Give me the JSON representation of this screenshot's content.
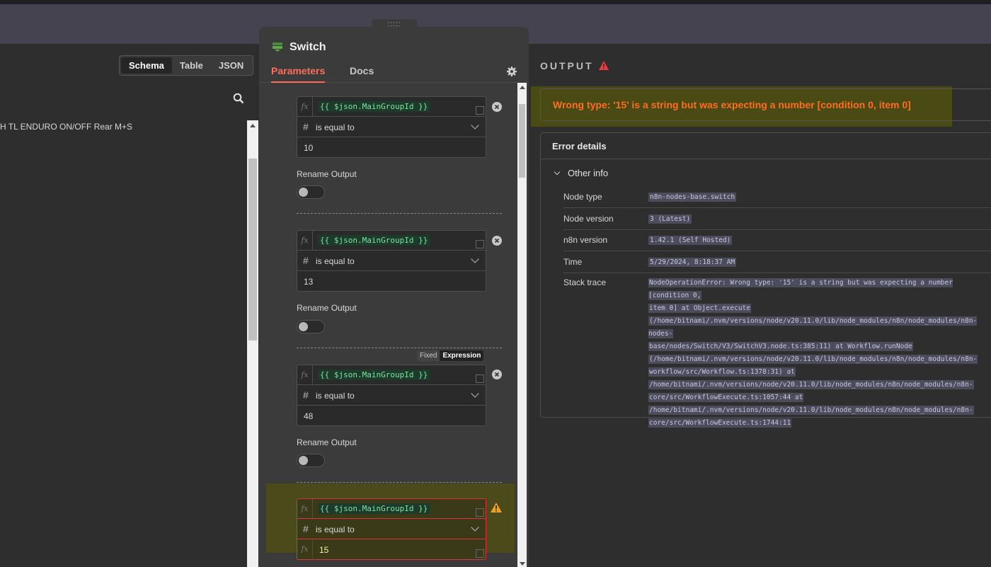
{
  "left": {
    "view_tabs": [
      "Schema",
      "Table",
      "JSON"
    ],
    "row_text": "H TL ENDURO ON/OFF Rear M+S"
  },
  "node": {
    "title": "Switch",
    "tabs": {
      "parameters": "Parameters",
      "docs": "Docs"
    },
    "fx_label": "fx",
    "rules": [
      {
        "expression": "{{ $json.MainGroupId }}",
        "operator": "is equal to",
        "value": "10"
      },
      {
        "expression": "{{ $json.MainGroupId }}",
        "operator": "is equal to",
        "value": "13"
      },
      {
        "expression": "{{ $json.MainGroupId }}",
        "operator": "is equal to",
        "value": "48"
      },
      {
        "expression": "{{ $json.MainGroupId }}",
        "operator": "is equal to",
        "value": "15"
      }
    ],
    "rename_output_label": "Rename Output",
    "fixed_label": "Fixed",
    "expression_label": "Expression",
    "drag_handle": ":::::"
  },
  "output": {
    "label": "OUTPUT",
    "error_message": "Wrong type: '15' is a string but was expecting a number [condition 0, item 0]",
    "details_title": "Error details",
    "other_info_label": "Other info",
    "info": {
      "node_type_key": "Node type",
      "node_type": "n8n-nodes-base.switch",
      "node_version_key": "Node version",
      "node_version": "3 (Latest)",
      "n8n_version_key": "n8n version",
      "n8n_version": "1.42.1 (Self Hosted)",
      "time_key": "Time",
      "time": "5/29/2024, 8:18:37 AM",
      "stack_key": "Stack trace"
    },
    "stack_lines": [
      "NodeOperationError: Wrong type: '15' is a string but was expecting a number [condition 0,",
      "item 0] at Object.execute",
      "(/home/bitnami/.nvm/versions/node/v20.11.0/lib/node_modules/n8n/node_modules/n8n-nodes-",
      "base/nodes/Switch/V3/SwitchV3.node.ts:385:11) at Workflow.runNode",
      "(/home/bitnami/.nvm/versions/node/v20.11.0/lib/node_modules/n8n/node_modules/n8n-",
      "workflow/src/Workflow.ts:1378:31) at",
      "/home/bitnami/.nvm/versions/node/v20.11.0/lib/node_modules/n8n/node_modules/n8n-",
      "core/src/WorkflowExecute.ts:1057:44 at",
      "/home/bitnami/.nvm/versions/node/v20.11.0/lib/node_modules/n8n/node_modules/n8n-",
      "core/src/WorkflowExecute.ts:1744:11"
    ]
  },
  "colors": {
    "accent": "#ff6d5a",
    "error_text": "#ff6d1f",
    "warning": "#ea3d43",
    "expr_green": "#7de3a3"
  }
}
